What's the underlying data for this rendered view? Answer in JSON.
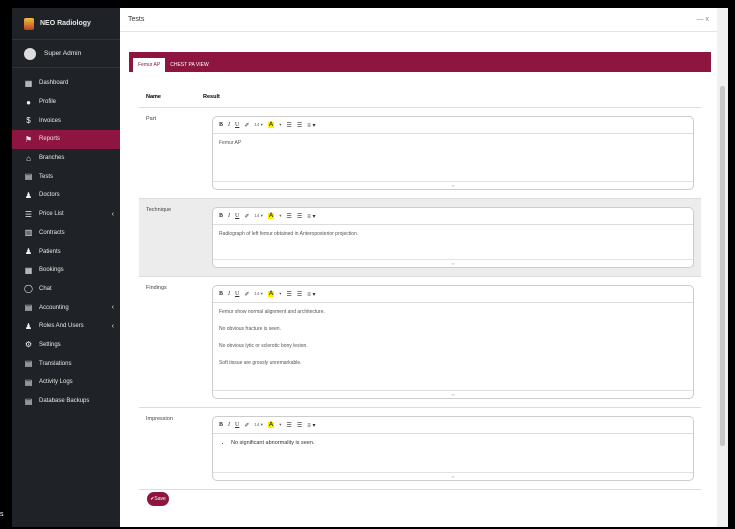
{
  "sidebar": {
    "brand": "NEO Radiology",
    "user": "Super Admin",
    "items": [
      {
        "label": "Dashboard",
        "icon": "▦"
      },
      {
        "label": "Profile",
        "icon": "●"
      },
      {
        "label": "Invoices",
        "icon": "$"
      },
      {
        "label": "Reports",
        "icon": "⚑",
        "active": true
      },
      {
        "label": "Branches",
        "icon": "⌂"
      },
      {
        "label": "Tests",
        "icon": "▤"
      },
      {
        "label": "Doctors",
        "icon": "♟"
      },
      {
        "label": "Price List",
        "icon": "☰",
        "chevron": "‹"
      },
      {
        "label": "Contracts",
        "icon": "▥"
      },
      {
        "label": "Patients",
        "icon": "♟"
      },
      {
        "label": "Bookings",
        "icon": "▦"
      },
      {
        "label": "Chat",
        "icon": "◯"
      },
      {
        "label": "Accounting",
        "icon": "▤",
        "chevron": "‹"
      },
      {
        "label": "Roles And Users",
        "icon": "♟",
        "chevron": "‹"
      },
      {
        "label": "Settings",
        "icon": "⚙"
      },
      {
        "label": "Translations",
        "icon": "▤"
      },
      {
        "label": "Activity Logs",
        "icon": "▤"
      },
      {
        "label": "Database Backups",
        "icon": "▤"
      }
    ]
  },
  "header": {
    "title": "Tests",
    "controls": "— x"
  },
  "tabs": [
    "Femur AP",
    "CHEST PA VIEW"
  ],
  "table": {
    "col_name": "Name",
    "col_result": "Result",
    "rows": [
      {
        "name": "Part",
        "lines": [
          "Femur AP"
        ]
      },
      {
        "name": "Technique",
        "lines": [
          "Radiograph of left femur obtained in Anteroposterior projection."
        ]
      },
      {
        "name": "Findings",
        "lines": [
          "Femur show normal alignment and architecture.",
          "No obvious fracture is seen.",
          "No obvious lytic or sclerotic bony lesion.",
          "Soft tissue are grossly unremarkable."
        ]
      },
      {
        "name": "Impression",
        "bullets": [
          "No significant abnormality is seen."
        ]
      }
    ]
  },
  "toolbar": {
    "bold": "B",
    "italic": "I",
    "underline": "U",
    "eraser": "✐",
    "size": "14 ▾",
    "highlight": "A",
    "highlight_arrow": "▾",
    "ul": "☰",
    "ol": "☰",
    "align": "≡ ▾"
  },
  "save_label": "✔Save",
  "colors": {
    "accent": "#8d1540",
    "sidebar": "#1f2327"
  }
}
